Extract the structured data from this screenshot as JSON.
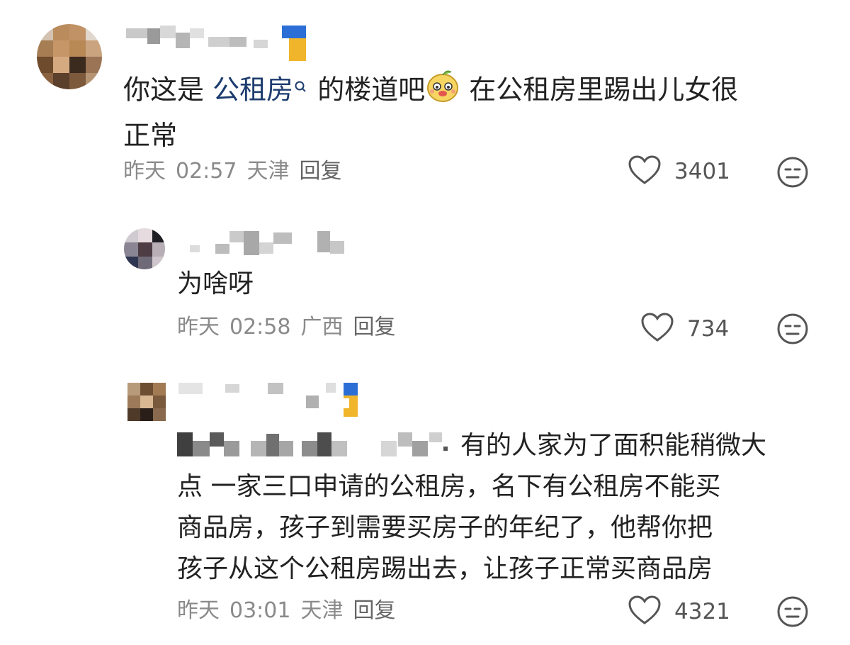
{
  "comments": [
    {
      "text_before_link": "你这是 ",
      "link_text": "公租房",
      "text_after_link": " 的楼道吧",
      "text_after_emoji": " 在公租房里踢出儿女很",
      "text_line2": "正常",
      "date": "昨天",
      "time": "02:57",
      "location": "天津",
      "reply_label": "回复",
      "likes": "3401"
    },
    {
      "text": "为啥呀",
      "date": "昨天",
      "time": "02:58",
      "location": "广西",
      "reply_label": "回复",
      "likes": "734"
    },
    {
      "text_line1": "有的人家为了面积能稍微大",
      "text_line2": "点 一家三口申请的公租房，名下有公租房不能买",
      "text_line3": "商品房，孩子到需要买房子的年纪了，他帮你把",
      "text_line4": "孩子从这个公租房踢出去，让孩子正常买商品房",
      "date": "昨天",
      "time": "03:01",
      "location": "天津",
      "reply_label": "回复",
      "likes": "4321"
    }
  ],
  "icons": {
    "like": "heart-outline-icon",
    "dislike": "neutral-face-icon",
    "link_search": "search-icon",
    "emoji": "cute-face-emoji"
  },
  "colors": {
    "link": "#1d3c6e",
    "meta": "#8a8a8a",
    "badge_blue": "#2b6fd6",
    "badge_yellow": "#f0b52a"
  }
}
